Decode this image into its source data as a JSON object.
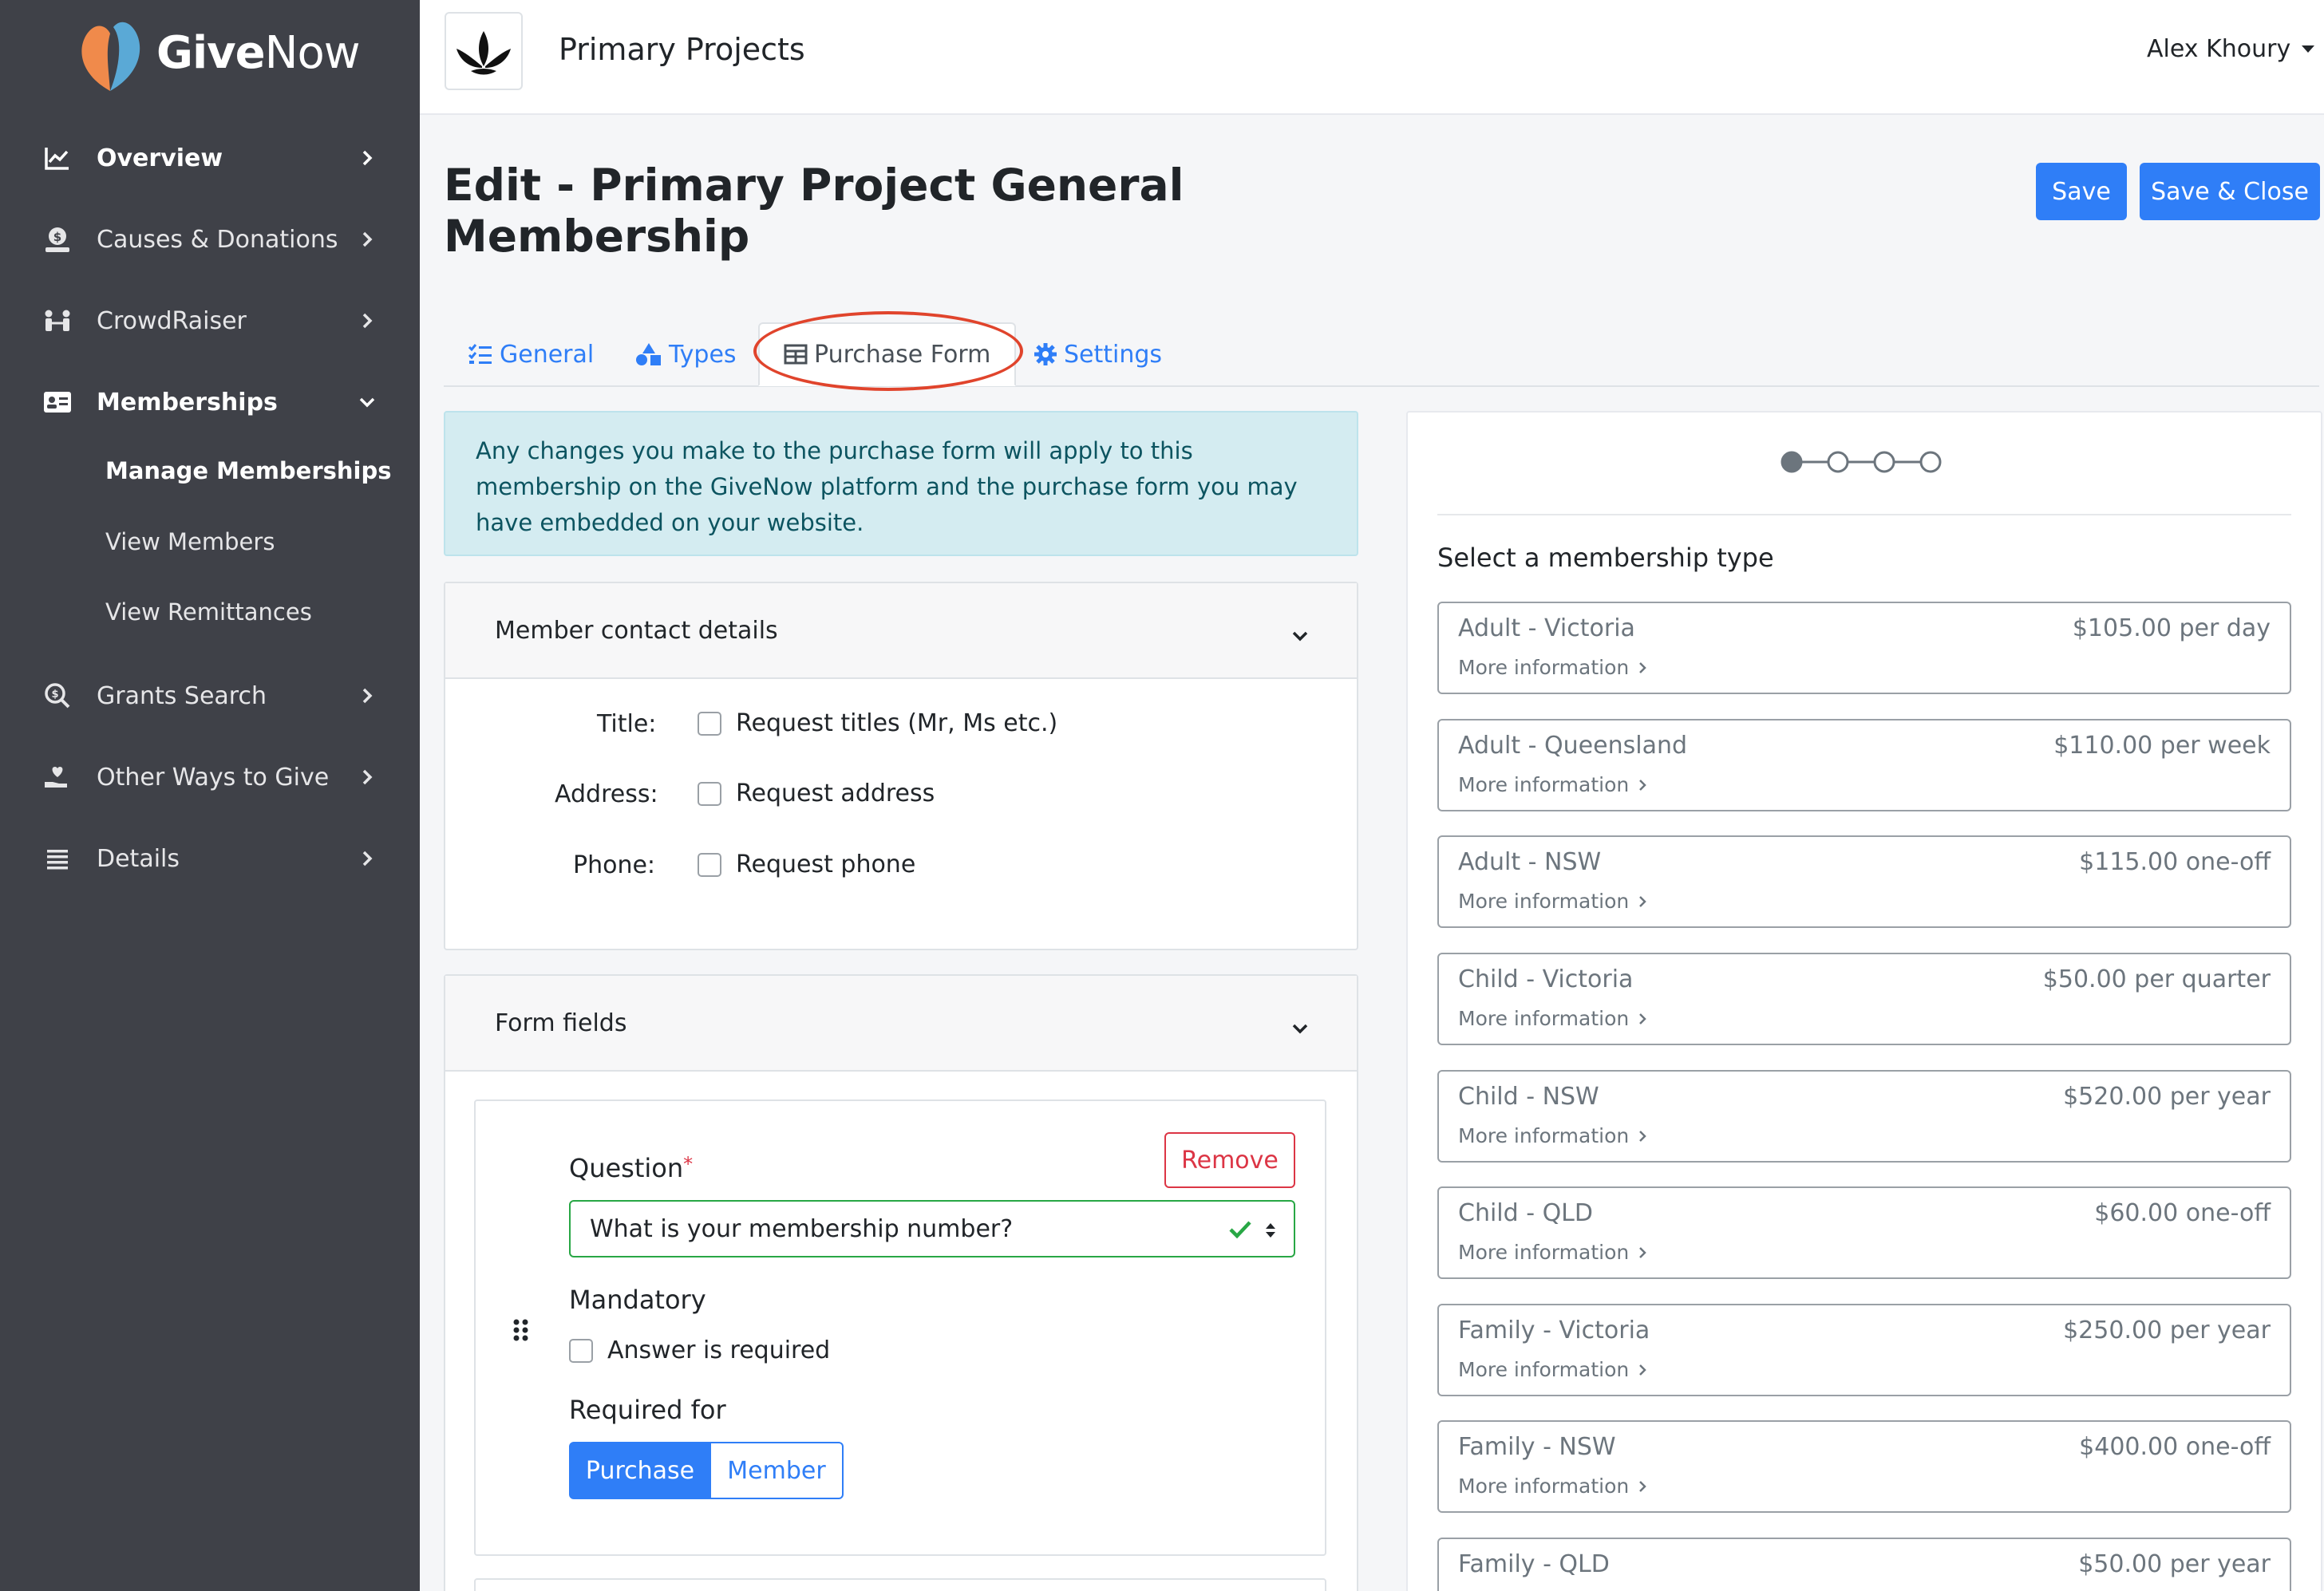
{
  "brand": {
    "name_bold": "Give",
    "name_light": "Now"
  },
  "sidebar": {
    "items": [
      {
        "label": "Overview",
        "icon": "chart-line-icon"
      },
      {
        "label": "Causes & Donations",
        "icon": "donate-icon"
      },
      {
        "label": "CrowdRaiser",
        "icon": "people-icon"
      },
      {
        "label": "Memberships",
        "icon": "id-card-icon"
      },
      {
        "label": "Grants Search",
        "icon": "search-dollar-icon"
      },
      {
        "label": "Other Ways to Give",
        "icon": "hand-heart-icon"
      },
      {
        "label": "Details",
        "icon": "list-icon"
      }
    ],
    "sub_items": [
      "Manage Memberships",
      "View Members",
      "View Remittances"
    ]
  },
  "header": {
    "org_name": "Primary Projects",
    "user_name": "Alex Khoury"
  },
  "page": {
    "title": "Edit - Primary Project General Membership",
    "save_label": "Save",
    "save_close_label": "Save & Close"
  },
  "tabs": [
    {
      "label": "General",
      "icon": "list-check-icon"
    },
    {
      "label": "Types",
      "icon": "shapes-icon"
    },
    {
      "label": "Purchase Form",
      "icon": "table-icon"
    },
    {
      "label": "Settings",
      "icon": "gear-icon"
    }
  ],
  "alert": {
    "text": "Any changes you make to the purchase form will apply to this membership on the GiveNow platform and the purchase form you may have embedded on your website."
  },
  "contact_card": {
    "title": "Member contact details",
    "rows": [
      {
        "label": "Title:",
        "option": "Request titles (Mr, Ms etc.)"
      },
      {
        "label": "Address:",
        "option": "Request address"
      },
      {
        "label": "Phone:",
        "option": "Request phone"
      }
    ]
  },
  "form_fields_card": {
    "title": "Form fields",
    "question_label": "Question",
    "required_mark": "*",
    "question_value": "What is your membership number?",
    "remove_label": "Remove",
    "mandatory_label": "Mandatory",
    "mandatory_option": "Answer is required",
    "required_for_label": "Required for",
    "required_for_options": [
      "Purchase",
      "Member"
    ]
  },
  "preview": {
    "heading": "Select a membership type",
    "steps_total": 4,
    "steps_current": 1,
    "more_info_label": "More information",
    "types": [
      {
        "name": "Adult - Victoria",
        "price": "$105.00 per day"
      },
      {
        "name": "Adult - Queensland",
        "price": "$110.00 per week"
      },
      {
        "name": "Adult - NSW",
        "price": "$115.00 one-off"
      },
      {
        "name": "Child - Victoria",
        "price": "$50.00 per quarter"
      },
      {
        "name": "Child - NSW",
        "price": "$520.00 per year"
      },
      {
        "name": "Child - QLD",
        "price": "$60.00 one-off"
      },
      {
        "name": "Family - Victoria",
        "price": "$250.00 per year"
      },
      {
        "name": "Family - NSW",
        "price": "$400.00 one-off"
      },
      {
        "name": "Family - QLD",
        "price": "$50.00 per year"
      }
    ]
  },
  "colors": {
    "primary": "#2f7ef7",
    "sidebar": "#3f4148",
    "danger": "#dc3545",
    "success": "#28a745",
    "annotation": "#e0442c"
  }
}
